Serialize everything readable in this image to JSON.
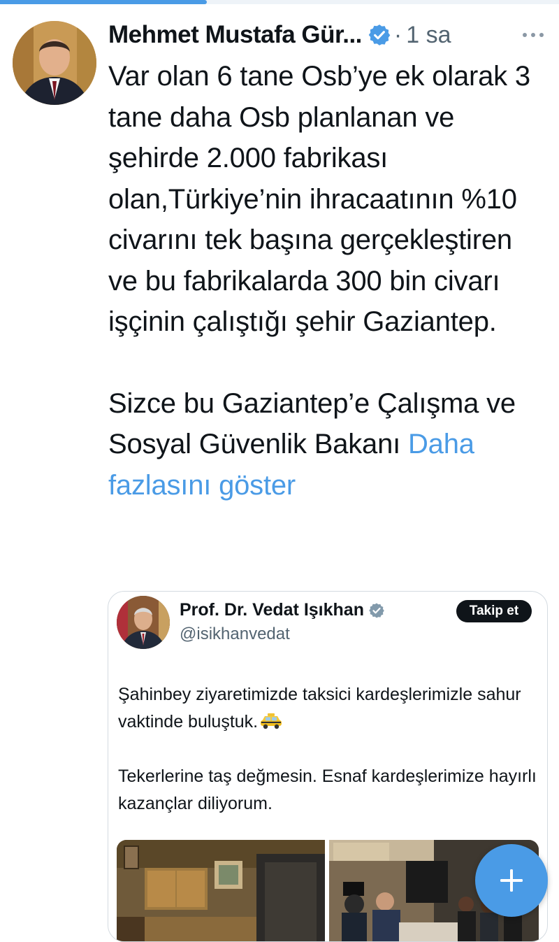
{
  "page": {
    "progress_fraction": 0.37
  },
  "tweet": {
    "author_name": "Mehmet Mustafa Gür...",
    "separator": "·",
    "time": "1 sa",
    "paragraphs": [
      "Var olan 6 tane Osb’ye ek olarak 3 tane daha Osb planlanan ve şehirde 2.000 fabrikası olan,Türkiye’nin ihracaatının %10 civarını tek başına gerçekleştiren ve bu fabrikalarda 300 bin civarı işçinin çalıştığı şehir Gaziantep.",
      "Sizce bu Gaziantep’e Çalışma ve Sosyal Güvenlik Bakanı"
    ],
    "show_more_label": "Daha fazlasını göster"
  },
  "quote": {
    "author_name": "Prof. Dr. Vedat Işıkhan",
    "handle": "@isikhanvedat",
    "follow_label": "Takip et",
    "paragraphs": [
      "Şahinbey ziyaretimizde taksici kardeşlerimizle sahur vaktinde buluştuk.",
      "Tekerlerine taş değmesin. Esnaf kardeşlerimize hayırlı kazançlar diliyorum."
    ],
    "emoji": "taxi-icon"
  },
  "icons": {
    "verified": "verified-badge-icon",
    "more": "more-icon",
    "compose": "plus-icon"
  },
  "colors": {
    "accent": "#4a9be6",
    "text": "#0f1419",
    "muted": "#536471",
    "border": "#d4dbe1"
  }
}
